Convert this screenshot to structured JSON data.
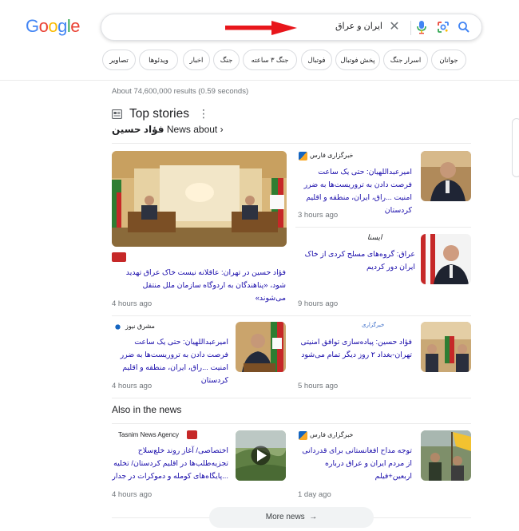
{
  "search": {
    "query": "ایران و عراق"
  },
  "chips": [
    "جوانان",
    "اسرار جنگ",
    "پخش فوتبال",
    "فوتبال",
    "جنگ ۳ ساعته",
    "جنگ",
    "اخبار",
    "ویدئوها",
    "تصاویر"
  ],
  "result_stats": "About 74,600,000 results (0.59 seconds)",
  "top_stories": {
    "title": "Top stories",
    "news_about_prefix": "News about",
    "news_about_name": "فؤاد حسین"
  },
  "stories": {
    "big": {
      "headline": "فؤاد حسین در تهران: عاقلانه نیست خاک عراق تهدید شود، «پناهندگان به اردوگاه سازمان ملل منتقل می‌شوند»",
      "time": "4 hours ago"
    },
    "right1": {
      "source": "خبرگزاری فارس",
      "headline": "امیرعبداللهیان: حتی یک ساعت فرصت دادن به تروریست‌ها به ضرر امنیت ...راق، ایران، منطقه و اقلیم کردستان",
      "time": "3 hours ago"
    },
    "right2": {
      "source": "ایسنا",
      "headline": "عراق: گروه‌های مسلح کردی از خاک ایران دور کردیم",
      "time": "9 hours ago"
    },
    "bottom_left": {
      "source": "مشرق نیوز",
      "headline": "امیرعبداللهیان: حتی یک ساعت فرصت دادن به تروریست‌ها به ضرر امنیت ...راق، ایران، منطقه و اقلیم کردستان",
      "time": "4 hours ago"
    },
    "bottom_right": {
      "source": "خبرگزاری",
      "headline": "فؤاد حسین: پیاده‌سازی توافق امنیتی تهران-بغداد ۲ روز دیگر تمام می‌شود",
      "time": "5 hours ago"
    }
  },
  "also_in_news": {
    "title": "Also in the news",
    "left": {
      "source": "Tasnim News Agency",
      "headline": "اختصاصی/ آغاز روند خلع‌سلاح تجزیه‌طلب‌ها در اقلیم کردستان/ تخلیه ...پایگاه‌های کومله و دموکرات در جدار",
      "time": "4 hours ago"
    },
    "right": {
      "source": "خبرگزاری فارس",
      "headline": "توجه مداح افغانستانی برای قدردانی از مردم ایران و عراق درباره اربعین+فیلم",
      "time": "1 day ago"
    }
  },
  "more_news": "More news",
  "colors": {
    "link": "#1a0dab",
    "arrow": "#e8161b",
    "muted": "#70757a"
  }
}
